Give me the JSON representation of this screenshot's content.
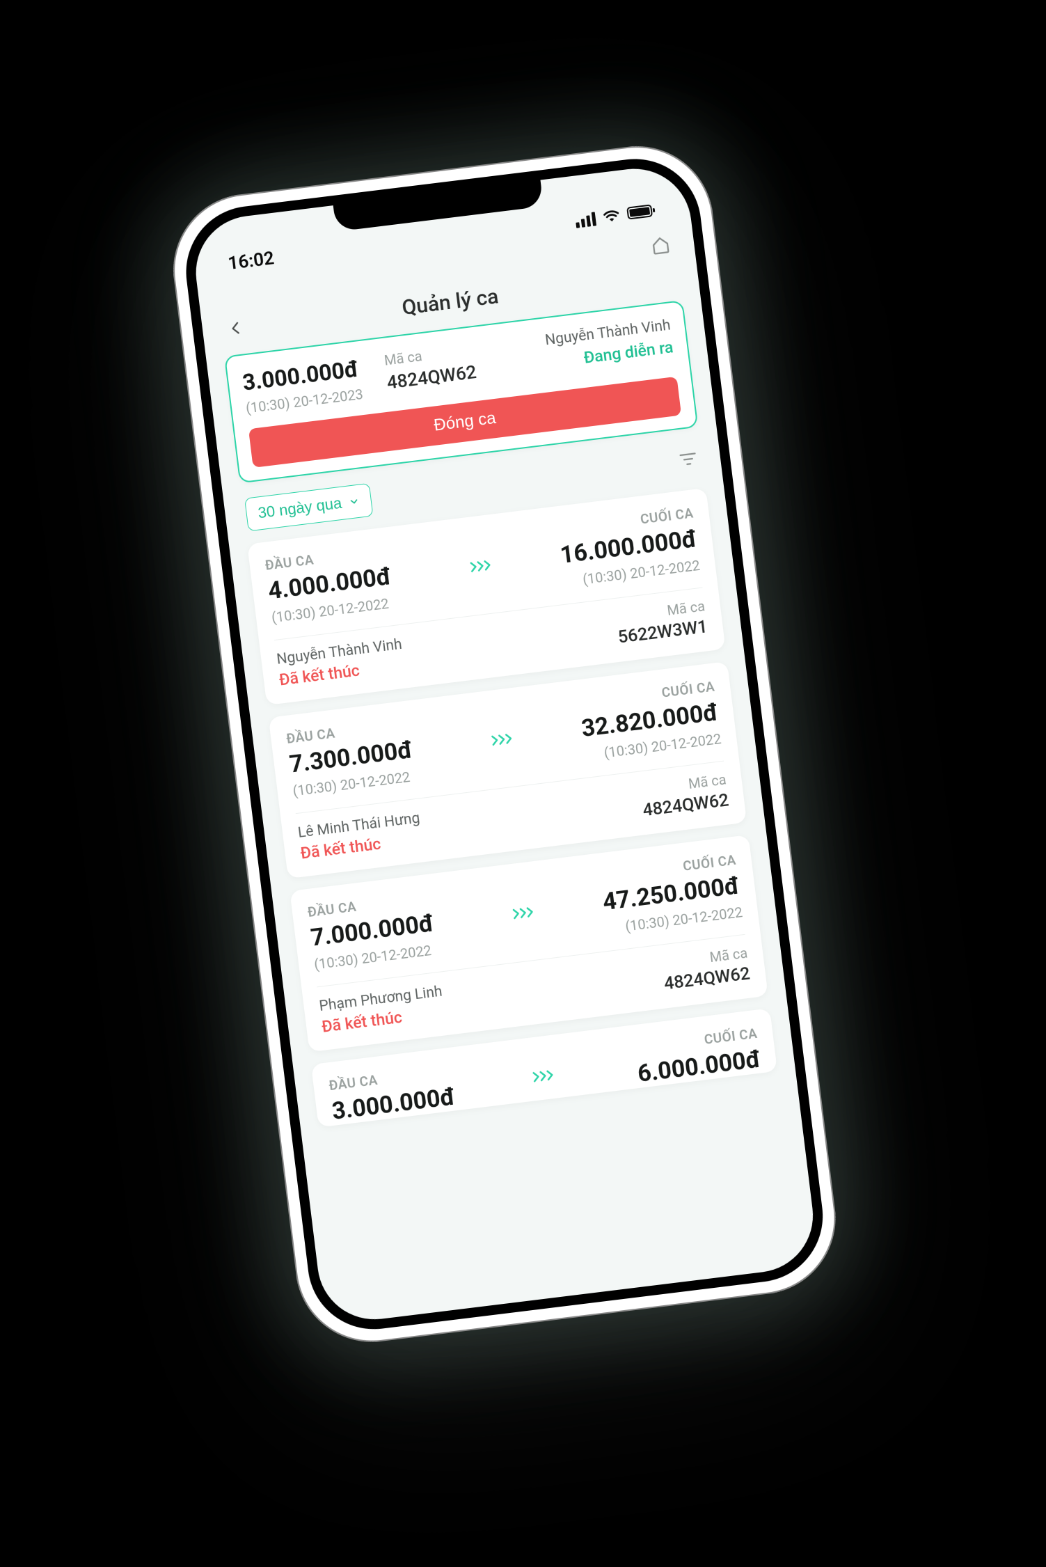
{
  "status_bar": {
    "time": "16:02"
  },
  "header": {
    "title": "Quản lý ca"
  },
  "labels": {
    "shift_code": "Mã ca",
    "start": "ĐẦU CA",
    "end": "CUỐI CA"
  },
  "current_shift": {
    "amount": "3.000.000đ",
    "timestamp": "(10:30) 20-12-2023",
    "code": "4824QW62",
    "user": "Nguyễn Thành Vinh",
    "status": "Đang diễn ra",
    "close_button": "Đóng ca"
  },
  "filter": {
    "range_label": "30 ngày qua"
  },
  "history": [
    {
      "start_amount": "4.000.000đ",
      "start_ts": "(10:30) 20-12-2022",
      "end_amount": "16.000.000đ",
      "end_ts": "(10:30) 20-12-2022",
      "user": "Nguyễn Thành Vinh",
      "status": "Đã kết thúc",
      "code": "5622W3W1"
    },
    {
      "start_amount": "7.300.000đ",
      "start_ts": "(10:30) 20-12-2022",
      "end_amount": "32.820.000đ",
      "end_ts": "(10:30) 20-12-2022",
      "user": "Lê Minh Thái Hưng",
      "status": "Đã kết thúc",
      "code": "4824QW62"
    },
    {
      "start_amount": "7.000.000đ",
      "start_ts": "(10:30) 20-12-2022",
      "end_amount": "47.250.000đ",
      "end_ts": "(10:30) 20-12-2022",
      "user": "Phạm Phương Linh",
      "status": "Đã kết thúc",
      "code": "4824QW62"
    },
    {
      "start_amount": "3.000.000đ",
      "start_ts": "",
      "end_amount": "6.000.000đ",
      "end_ts": "",
      "user": "",
      "status": "",
      "code": ""
    }
  ]
}
